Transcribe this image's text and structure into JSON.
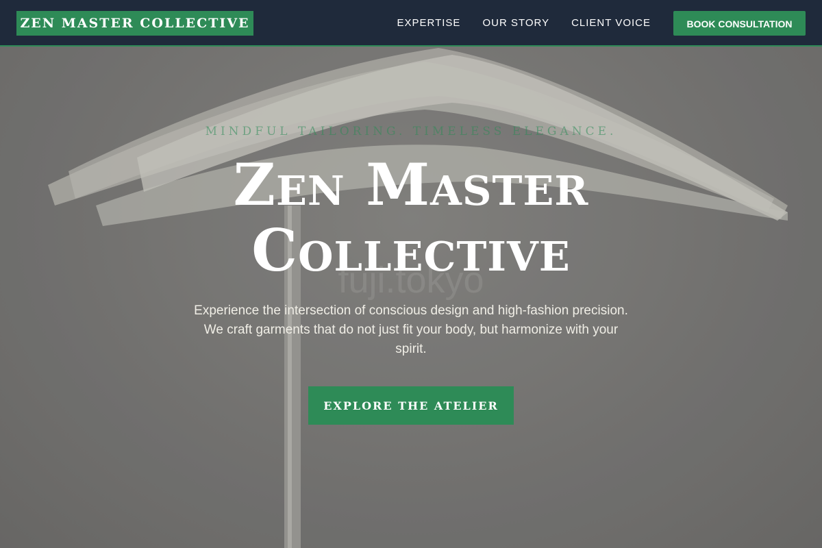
{
  "nav": {
    "logo": "ZEN MASTER COLLECTIVE",
    "links": [
      "EXPERTISE",
      "OUR STORY",
      "CLIENT VOICE"
    ],
    "cta": "BOOK CONSULTATION"
  },
  "hero": {
    "tagline": "MINDFUL TAILORING. TIMELESS ELEGANCE.",
    "title_lines": [
      "Zen Master",
      "Collective"
    ],
    "description": "Experience the intersection of conscious design and high-fashion precision. We craft garments that do not just fit your body, but harmonize with your spirit.",
    "cta": "EXPLORE THE ATELIER",
    "watermark": "fuji.tokyo"
  },
  "colors": {
    "nav_background": "#1f2a3b",
    "accent_green": "#2e8b57",
    "hero_overlay": "#7a7977",
    "text_light": "#ffffff"
  },
  "icons": {
    "background_photo": "clothes-hangers-photo"
  }
}
